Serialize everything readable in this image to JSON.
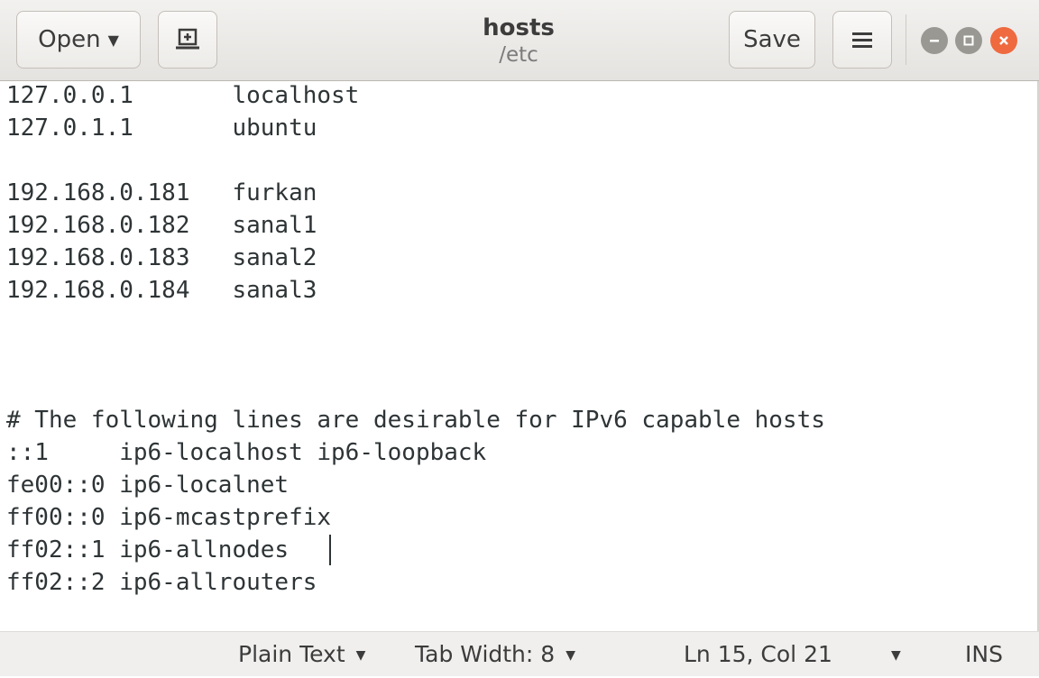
{
  "header": {
    "open_label": "Open",
    "save_label": "Save",
    "title": "hosts",
    "subtitle": "/etc"
  },
  "editor": {
    "lines": [
      "127.0.0.1       localhost",
      "127.0.1.1       ubuntu",
      "",
      "192.168.0.181   furkan",
      "192.168.0.182   sanal1",
      "192.168.0.183   sanal2",
      "192.168.0.184   sanal3",
      "",
      "",
      "",
      "# The following lines are desirable for IPv6 capable hosts",
      "::1     ip6-localhost ip6-loopback",
      "fe00::0 ip6-localnet",
      "ff00::0 ip6-mcastprefix",
      "ff02::1 ip6-allnodes",
      "ff02::2 ip6-allrouters"
    ]
  },
  "statusbar": {
    "language": "Plain Text",
    "tab_width": "Tab Width: 8",
    "position": "Ln 15, Col 21",
    "mode": "INS"
  },
  "colors": {
    "close_button": "#ef6a3f",
    "window_button": "#9a9893",
    "text": "#2e3436"
  },
  "icons": [
    "caret-down-icon",
    "new-tab-icon",
    "hamburger-menu-icon",
    "minimize-icon",
    "maximize-icon",
    "close-icon"
  ]
}
